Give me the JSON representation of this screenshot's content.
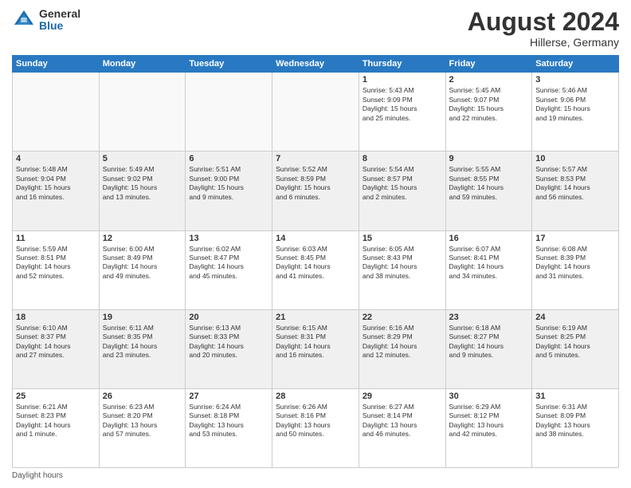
{
  "header": {
    "logo_general": "General",
    "logo_blue": "Blue",
    "title": "August 2024",
    "location": "Hillerse, Germany"
  },
  "weekdays": [
    "Sunday",
    "Monday",
    "Tuesday",
    "Wednesday",
    "Thursday",
    "Friday",
    "Saturday"
  ],
  "footer": {
    "note": "Daylight hours"
  },
  "weeks": [
    [
      {
        "day": "",
        "info": ""
      },
      {
        "day": "",
        "info": ""
      },
      {
        "day": "",
        "info": ""
      },
      {
        "day": "",
        "info": ""
      },
      {
        "day": "1",
        "info": "Sunrise: 5:43 AM\nSunset: 9:09 PM\nDaylight: 15 hours\nand 25 minutes."
      },
      {
        "day": "2",
        "info": "Sunrise: 5:45 AM\nSunset: 9:07 PM\nDaylight: 15 hours\nand 22 minutes."
      },
      {
        "day": "3",
        "info": "Sunrise: 5:46 AM\nSunset: 9:06 PM\nDaylight: 15 hours\nand 19 minutes."
      }
    ],
    [
      {
        "day": "4",
        "info": "Sunrise: 5:48 AM\nSunset: 9:04 PM\nDaylight: 15 hours\nand 16 minutes."
      },
      {
        "day": "5",
        "info": "Sunrise: 5:49 AM\nSunset: 9:02 PM\nDaylight: 15 hours\nand 13 minutes."
      },
      {
        "day": "6",
        "info": "Sunrise: 5:51 AM\nSunset: 9:00 PM\nDaylight: 15 hours\nand 9 minutes."
      },
      {
        "day": "7",
        "info": "Sunrise: 5:52 AM\nSunset: 8:59 PM\nDaylight: 15 hours\nand 6 minutes."
      },
      {
        "day": "8",
        "info": "Sunrise: 5:54 AM\nSunset: 8:57 PM\nDaylight: 15 hours\nand 2 minutes."
      },
      {
        "day": "9",
        "info": "Sunrise: 5:55 AM\nSunset: 8:55 PM\nDaylight: 14 hours\nand 59 minutes."
      },
      {
        "day": "10",
        "info": "Sunrise: 5:57 AM\nSunset: 8:53 PM\nDaylight: 14 hours\nand 56 minutes."
      }
    ],
    [
      {
        "day": "11",
        "info": "Sunrise: 5:59 AM\nSunset: 8:51 PM\nDaylight: 14 hours\nand 52 minutes."
      },
      {
        "day": "12",
        "info": "Sunrise: 6:00 AM\nSunset: 8:49 PM\nDaylight: 14 hours\nand 49 minutes."
      },
      {
        "day": "13",
        "info": "Sunrise: 6:02 AM\nSunset: 8:47 PM\nDaylight: 14 hours\nand 45 minutes."
      },
      {
        "day": "14",
        "info": "Sunrise: 6:03 AM\nSunset: 8:45 PM\nDaylight: 14 hours\nand 41 minutes."
      },
      {
        "day": "15",
        "info": "Sunrise: 6:05 AM\nSunset: 8:43 PM\nDaylight: 14 hours\nand 38 minutes."
      },
      {
        "day": "16",
        "info": "Sunrise: 6:07 AM\nSunset: 8:41 PM\nDaylight: 14 hours\nand 34 minutes."
      },
      {
        "day": "17",
        "info": "Sunrise: 6:08 AM\nSunset: 8:39 PM\nDaylight: 14 hours\nand 31 minutes."
      }
    ],
    [
      {
        "day": "18",
        "info": "Sunrise: 6:10 AM\nSunset: 8:37 PM\nDaylight: 14 hours\nand 27 minutes."
      },
      {
        "day": "19",
        "info": "Sunrise: 6:11 AM\nSunset: 8:35 PM\nDaylight: 14 hours\nand 23 minutes."
      },
      {
        "day": "20",
        "info": "Sunrise: 6:13 AM\nSunset: 8:33 PM\nDaylight: 14 hours\nand 20 minutes."
      },
      {
        "day": "21",
        "info": "Sunrise: 6:15 AM\nSunset: 8:31 PM\nDaylight: 14 hours\nand 16 minutes."
      },
      {
        "day": "22",
        "info": "Sunrise: 6:16 AM\nSunset: 8:29 PM\nDaylight: 14 hours\nand 12 minutes."
      },
      {
        "day": "23",
        "info": "Sunrise: 6:18 AM\nSunset: 8:27 PM\nDaylight: 14 hours\nand 9 minutes."
      },
      {
        "day": "24",
        "info": "Sunrise: 6:19 AM\nSunset: 8:25 PM\nDaylight: 14 hours\nand 5 minutes."
      }
    ],
    [
      {
        "day": "25",
        "info": "Sunrise: 6:21 AM\nSunset: 8:23 PM\nDaylight: 14 hours\nand 1 minute."
      },
      {
        "day": "26",
        "info": "Sunrise: 6:23 AM\nSunset: 8:20 PM\nDaylight: 13 hours\nand 57 minutes."
      },
      {
        "day": "27",
        "info": "Sunrise: 6:24 AM\nSunset: 8:18 PM\nDaylight: 13 hours\nand 53 minutes."
      },
      {
        "day": "28",
        "info": "Sunrise: 6:26 AM\nSunset: 8:16 PM\nDaylight: 13 hours\nand 50 minutes."
      },
      {
        "day": "29",
        "info": "Sunrise: 6:27 AM\nSunset: 8:14 PM\nDaylight: 13 hours\nand 46 minutes."
      },
      {
        "day": "30",
        "info": "Sunrise: 6:29 AM\nSunset: 8:12 PM\nDaylight: 13 hours\nand 42 minutes."
      },
      {
        "day": "31",
        "info": "Sunrise: 6:31 AM\nSunset: 8:09 PM\nDaylight: 13 hours\nand 38 minutes."
      }
    ]
  ]
}
